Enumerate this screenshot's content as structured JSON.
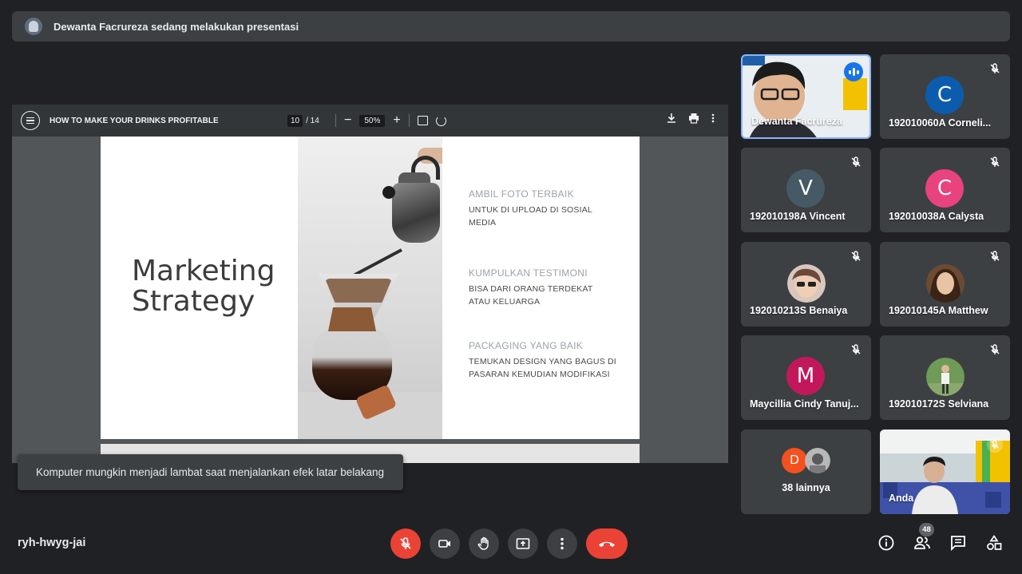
{
  "banner": {
    "text": "Dewanta Facrureza sedang melakukan presentasi",
    "icon": "presenter-avatar-icon"
  },
  "pdf": {
    "doc_title": "HOW TO MAKE YOUR DRINKS PROFITABLE",
    "page_current": "10",
    "page_total": "/ 14",
    "zoom": "50%",
    "zoom_out": "−",
    "zoom_in": "+"
  },
  "slide": {
    "title_line1": "Marketing",
    "title_line2": "Strategy",
    "tips": [
      {
        "heading": "AMBIL FOTO TERBAIK",
        "body": "UNTUK DI UPLOAD DI SOSIAL MEDIA"
      },
      {
        "heading": "KUMPULKAN TESTIMONI",
        "body": "BISA DARI ORANG TERDEKAT ATAU KELUARGA"
      },
      {
        "heading": "PACKAGING YANG BAIK",
        "body": "TEMUKAN DESIGN YANG BAGUS DI PASARAN KEMUDIAN MODIFIKASI"
      }
    ]
  },
  "toast": "Komputer mungkin menjadi lambat saat menjalankan efek latar belakang",
  "participants": [
    {
      "name": "Dewanta Facrureza",
      "speaking": true
    },
    {
      "name": "192010060A Corneli...",
      "initial": "C",
      "color": "#0b5cad"
    },
    {
      "name": "192010198A Vincent",
      "initial": "V",
      "color": "#455a64"
    },
    {
      "name": "192010038A Calysta",
      "initial": "C",
      "color": "#e8437d"
    },
    {
      "name": "192010213S Benaiya"
    },
    {
      "name": "192010145A Matthew"
    },
    {
      "name": "Maycillia Cindy Tanuj...",
      "initial": "M",
      "color": "#c2185b"
    },
    {
      "name": "192010172S Selviana"
    },
    {
      "name": "Anda"
    }
  ],
  "more": {
    "label": "38 lainnya",
    "initial": "D",
    "color": "#f4511e"
  },
  "meeting_code": "ryh-hwyg-jai",
  "people_count": "48",
  "colors": {
    "bg": "#202124",
    "tile": "#3c4043",
    "danger": "#ea4335",
    "accent": "#1a73e8"
  }
}
